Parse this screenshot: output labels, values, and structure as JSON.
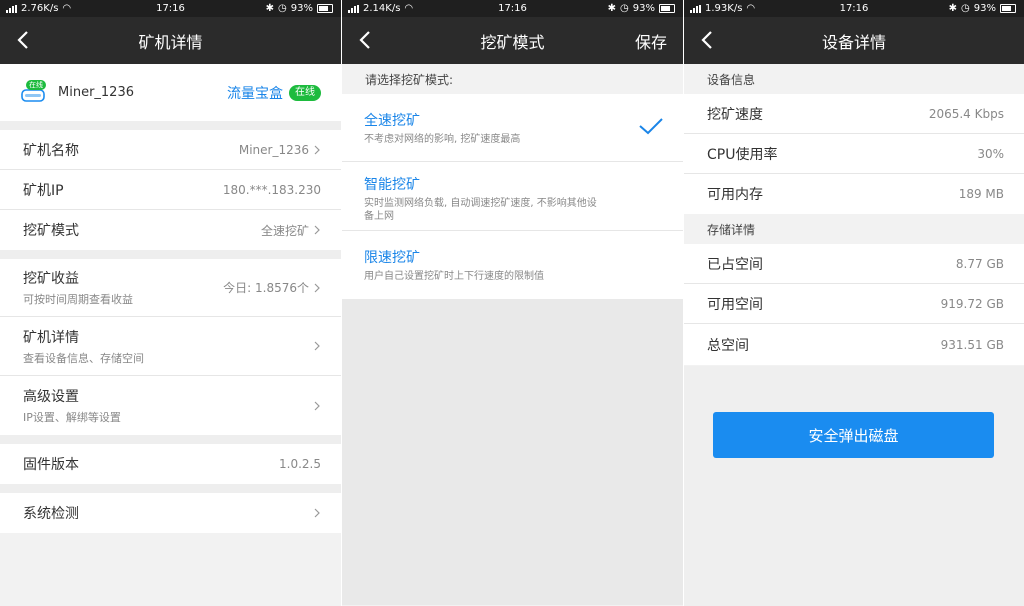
{
  "screens": [
    {
      "status": {
        "speed": "2.76K/s",
        "time": "17:16",
        "battery": "93%"
      },
      "nav": {
        "title": "矿机详情"
      },
      "header": {
        "device_badge": "在线",
        "device_name": "Miner_1236",
        "brand": "流量宝盒",
        "status_badge": "在线"
      },
      "rows": {
        "name": {
          "label": "矿机名称",
          "value": "Miner_1236"
        },
        "ip": {
          "label": "矿机IP",
          "value": "180.***.183.230"
        },
        "mode": {
          "label": "挖矿模式",
          "value": "全速挖矿"
        },
        "income": {
          "label": "挖矿收益",
          "sub": "可按时间周期查看收益",
          "value": "今日: 1.8576个"
        },
        "detail": {
          "label": "矿机详情",
          "sub": "查看设备信息、存储空间"
        },
        "advanced": {
          "label": "高级设置",
          "sub": "IP设置、解绑等设置"
        },
        "firmware": {
          "label": "固件版本",
          "value": "1.0.2.5"
        },
        "check": {
          "label": "系统检测"
        }
      }
    },
    {
      "status": {
        "speed": "2.14K/s",
        "time": "17:16",
        "battery": "93%"
      },
      "nav": {
        "title": "挖矿模式",
        "action": "保存"
      },
      "prompt": "请选择挖矿模式:",
      "modes": [
        {
          "name": "全速挖矿",
          "desc": "不考虑对网络的影响, 挖矿速度最高"
        },
        {
          "name": "智能挖矿",
          "desc": "实时监测网络负载, 自动调速挖矿速度, 不影响其他设备上网"
        },
        {
          "name": "限速挖矿",
          "desc": "用户自己设置挖矿时上下行速度的限制值"
        }
      ]
    },
    {
      "status": {
        "speed": "1.93K/s",
        "time": "17:16",
        "battery": "93%"
      },
      "nav": {
        "title": "设备详情"
      },
      "device_section": "设备信息",
      "device_rows": [
        {
          "label": "挖矿速度",
          "value": "2065.4 Kbps"
        },
        {
          "label": "CPU使用率",
          "value": "30%"
        },
        {
          "label": "可用内存",
          "value": "189 MB"
        }
      ],
      "storage_section": "存储详情",
      "storage_rows": [
        {
          "label": "已占空间",
          "value": "8.77 GB"
        },
        {
          "label": "可用空间",
          "value": "919.72 GB"
        },
        {
          "label": "总空间",
          "value": "931.51 GB"
        }
      ],
      "eject_button": "安全弹出磁盘"
    }
  ],
  "colors": {
    "accent": "#1a8cf0",
    "online": "#1dbb3e",
    "navbar": "#2b2b2b"
  }
}
